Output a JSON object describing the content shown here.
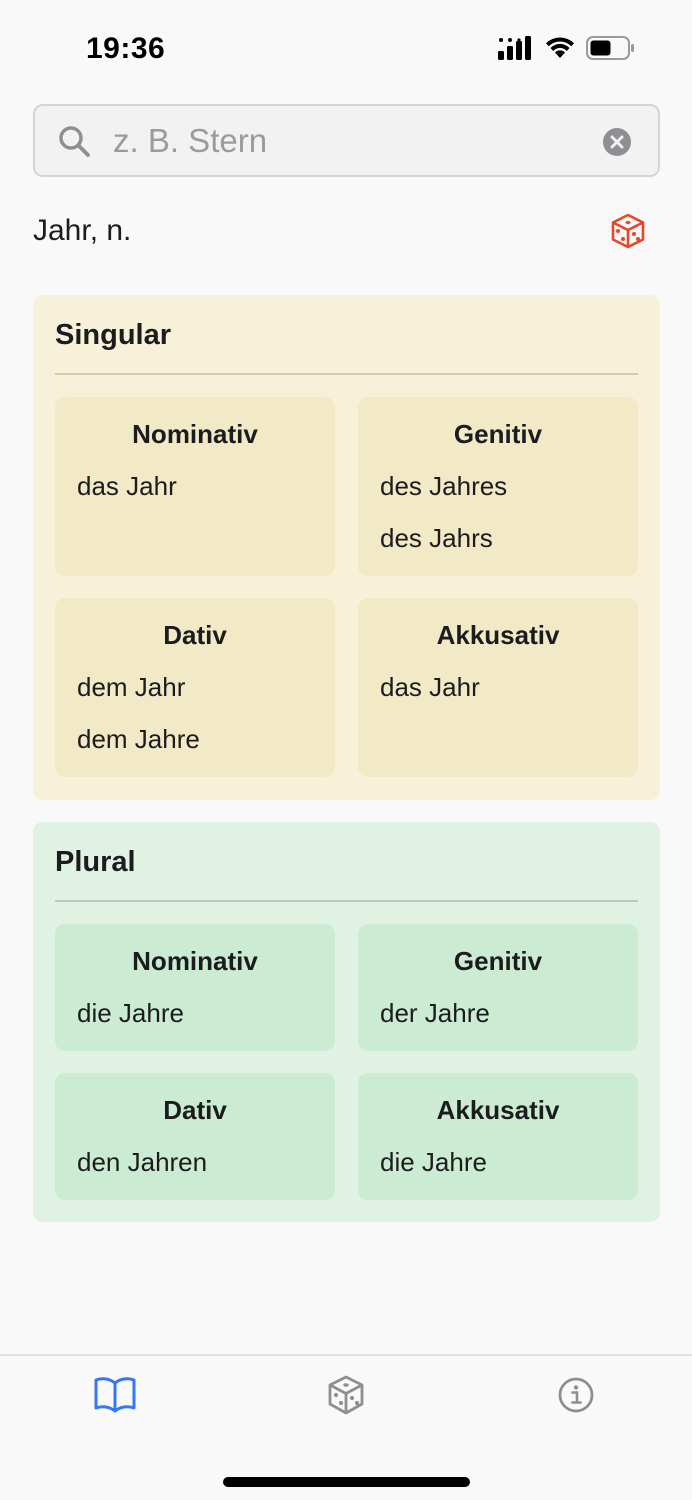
{
  "status": {
    "time": "19:36"
  },
  "search": {
    "placeholder": "z. B. Stern",
    "value": ""
  },
  "word": {
    "title": "Jahr, n."
  },
  "singular": {
    "title": "Singular",
    "cases": [
      {
        "name": "Nominativ",
        "forms": [
          "das Jahr"
        ]
      },
      {
        "name": "Genitiv",
        "forms": [
          "des Jahres",
          "des Jahrs"
        ]
      },
      {
        "name": "Dativ",
        "forms": [
          "dem Jahr",
          "dem Jahre"
        ]
      },
      {
        "name": "Akkusativ",
        "forms": [
          "das Jahr"
        ]
      }
    ]
  },
  "plural": {
    "title": "Plural",
    "cases": [
      {
        "name": "Nominativ",
        "forms": [
          "die Jahre"
        ]
      },
      {
        "name": "Genitiv",
        "forms": [
          "der Jahre"
        ]
      },
      {
        "name": "Dativ",
        "forms": [
          "den Jahren"
        ]
      },
      {
        "name": "Akkusativ",
        "forms": [
          "die Jahre"
        ]
      }
    ]
  },
  "tabs": [
    {
      "icon": "book-icon",
      "active": true
    },
    {
      "icon": "dice-icon",
      "active": false
    },
    {
      "icon": "info-icon",
      "active": false
    }
  ],
  "colors": {
    "accent": "#3478f6",
    "dice": "#e8472b",
    "singular_bg": "#f8f1d9",
    "plural_bg": "#dff2e3"
  }
}
